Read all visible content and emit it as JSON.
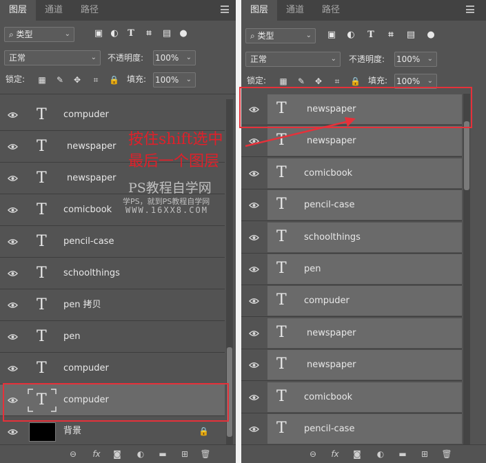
{
  "tabs": {
    "layers": "图层",
    "channels": "通道",
    "paths": "路径"
  },
  "toolbar": {
    "filter_kind": "类型",
    "filter_icons": [
      "image-icon",
      "adjustment-icon",
      "type-icon",
      "shape-icon",
      "smart-object-icon",
      "toggle-dot-icon"
    ],
    "blend_mode": "正常",
    "opacity_label": "不透明度:",
    "opacity_value": "100%",
    "lock_label": "锁定:",
    "fill_label": "填充:",
    "fill_value": "100%"
  },
  "left_panel": {
    "layers": [
      {
        "name": "compuder",
        "type": "text"
      },
      {
        "name": "newspaper",
        "type": "text"
      },
      {
        "name": "newspaper",
        "type": "text"
      },
      {
        "name": "comicbook",
        "type": "text"
      },
      {
        "name": "pencil-case",
        "type": "text"
      },
      {
        "name": "schoolthings",
        "type": "text"
      },
      {
        "name": "pen 拷贝",
        "type": "text"
      },
      {
        "name": "pen",
        "type": "text"
      },
      {
        "name": "compuder",
        "type": "text"
      },
      {
        "name": "compuder",
        "type": "text",
        "selected": true
      }
    ],
    "background_layer": {
      "name": "背景",
      "locked": true
    }
  },
  "right_panel": {
    "layers": [
      {
        "name": "newspaper",
        "type": "text",
        "selected": true
      },
      {
        "name": "newspaper",
        "type": "text",
        "selected": true
      },
      {
        "name": "comicbook",
        "type": "text",
        "selected": true
      },
      {
        "name": "pencil-case",
        "type": "text",
        "selected": true
      },
      {
        "name": "schoolthings",
        "type": "text",
        "selected": true
      },
      {
        "name": "pen",
        "type": "text",
        "selected": true
      },
      {
        "name": "compuder",
        "type": "text",
        "selected": true
      },
      {
        "name": "newspaper",
        "type": "text",
        "selected": true
      },
      {
        "name": "newspaper",
        "type": "text",
        "selected": true
      },
      {
        "name": "comicbook",
        "type": "text",
        "selected": true
      },
      {
        "name": "pencil-case",
        "type": "text",
        "selected": true
      }
    ]
  },
  "footer_icons": [
    "link-icon",
    "fx-icon",
    "mask-icon",
    "adjustment-icon",
    "folder-icon",
    "new-layer-icon",
    "trash-icon"
  ],
  "footer_fx": "fx",
  "annotation": {
    "line1": "按住shift选中",
    "line2": "最后一个图层"
  },
  "watermark": {
    "line1": "PS教程自学网",
    "line2": "学PS，就到PS教程自学网",
    "line3": "WWW.16XX8.COM"
  },
  "colors": {
    "panel_bg": "#535353",
    "tab_bar": "#424242",
    "selected_row": "#6a6a6a",
    "highlight_red": "#e6313a"
  }
}
